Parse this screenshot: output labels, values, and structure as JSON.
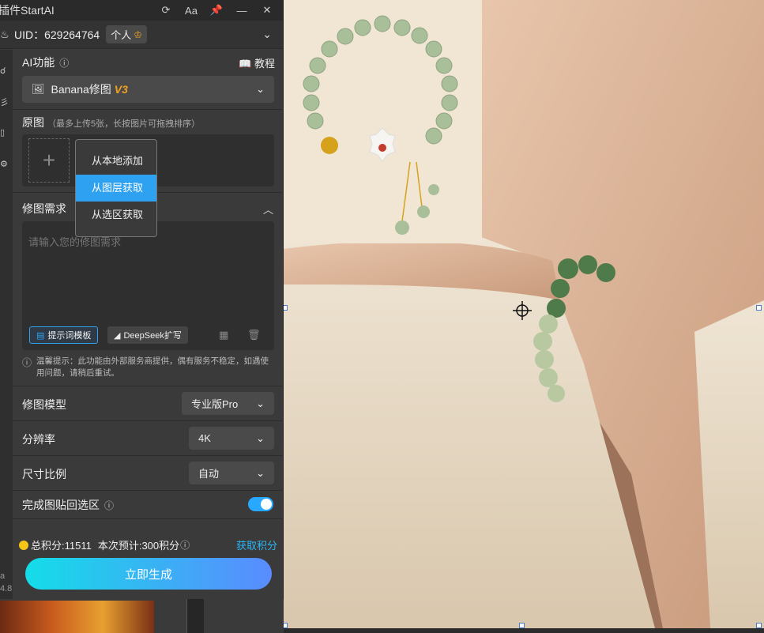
{
  "titlebar": {
    "title": "插件StartAI",
    "refresh_icon": "refresh-icon",
    "font_label": "Aa",
    "pin_icon": "pin-icon",
    "minimize_icon": "minimize-icon",
    "close_icon": "close-icon"
  },
  "account": {
    "uid_text": "UID：629264764",
    "tier": "个人",
    "chevron": "chevron-down-icon"
  },
  "ai_function": {
    "label": "AI功能",
    "tutorial": "教程",
    "selected": "Banana修图",
    "version": "V3"
  },
  "source_image": {
    "label": "原图",
    "hint": "（最多上传5张，长按图片可拖拽排序）"
  },
  "context_menu": {
    "items": [
      "从本地添加",
      "从图层获取",
      "从选区获取"
    ],
    "selected_index": 1
  },
  "edit_request": {
    "label": "修图需求",
    "placeholder": "请输入您的修图需求",
    "template_btn": "提示词模板",
    "deepseek_btn": "DeepSeek扩写"
  },
  "notice": {
    "text": "温馨提示：此功能由外部服务商提供，偶有服务不稳定，如遇使用问题，请稍后重试。"
  },
  "settings": {
    "model": {
      "label": "修图模型",
      "value": "专业版Pro"
    },
    "resolution": {
      "label": "分辨率",
      "value": "4K"
    },
    "aspect": {
      "label": "尺寸比例",
      "value": "自动"
    },
    "paste_back": {
      "label": "完成图贴回选区",
      "enabled": true
    }
  },
  "footer": {
    "points": "总积分:11511",
    "estimate": "本次预计:300积分",
    "get_points": "获取积分",
    "generate": "立即生成"
  },
  "left_rail": {
    "bottom_a": "a",
    "bottom_ver": "4.8"
  },
  "colors": {
    "accent": "#2ea1f0",
    "version_badge": "#f0a020",
    "link": "#29b6f6"
  }
}
